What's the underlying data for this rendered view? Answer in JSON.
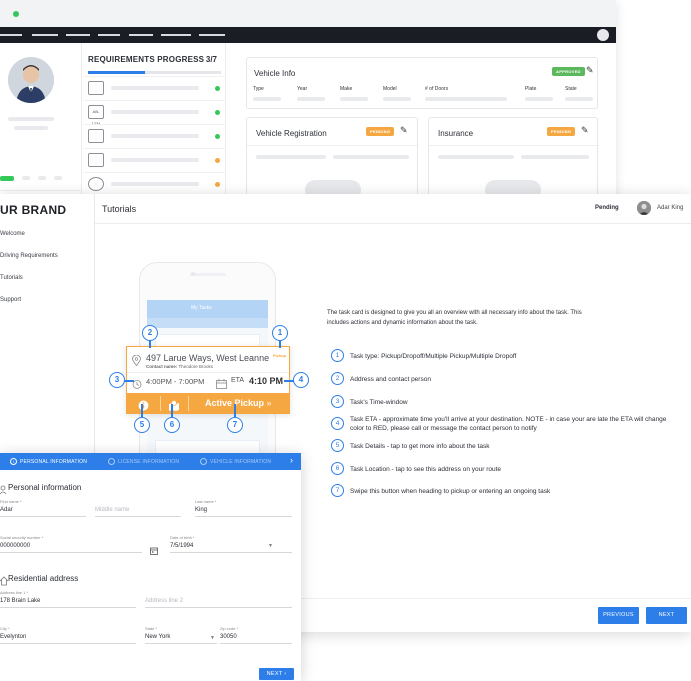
{
  "background_app": {
    "requirements": {
      "title": "REQUIREMENTS PROGRESS",
      "count": "3/7",
      "progress": 0.43,
      "rows": [
        {
          "icon": "id-card-icon",
          "icon_text": "",
          "status_color": "#34c759"
        },
        {
          "icon": "license-plate-icon",
          "icon_text": "AB-1234",
          "status_color": "#34c759"
        },
        {
          "icon": "document-icon",
          "icon_text": "",
          "status_color": "#34c759"
        },
        {
          "icon": "card-icon",
          "icon_text": "",
          "status_color": "#f5a742"
        },
        {
          "icon": "circle-icon",
          "icon_text": "",
          "status_color": "#f5a742"
        }
      ]
    },
    "vehicle_info": {
      "title": "Vehicle Info",
      "badge": "APPROVED",
      "badge_color": "#5cb85c",
      "columns": [
        "Type",
        "Year",
        "Make",
        "Model",
        "# of Doors",
        "Plate",
        "State"
      ]
    },
    "vehicle_registration": {
      "title": "Vehicle Registration",
      "badge": "PENDING",
      "badge_color": "#f5a742"
    },
    "insurance": {
      "title": "Insurance",
      "badge": "PENDING",
      "badge_color": "#f5a742"
    }
  },
  "main": {
    "brand": "UR BRAND",
    "nav": [
      "Welcome",
      "Driving Requirements",
      "Tutorials",
      "Support"
    ],
    "page_title": "Tutorials",
    "status": "Pending",
    "user_name": "Adar King",
    "phone": {
      "app_title": "My Tasks"
    },
    "task_card": {
      "address": "497 Larue Ways, West Leanne",
      "contact_label": "Contact name:",
      "contact_name": "Theodore Brooks",
      "task_type": "Pickup",
      "time_window": "4:00PM - 7:00PM",
      "eta_label": "ETA",
      "eta_value": "4:10 PM",
      "action_label": "Active Pickup",
      "action_arrow": "»"
    },
    "callouts": [
      "1",
      "2",
      "3",
      "4",
      "5",
      "6",
      "7"
    ],
    "description": "The task card is designed to give you all an overview with all necessary info about the task. This includes actions and dynamic information about the task.",
    "legend": [
      {
        "num": "1",
        "text": "Task type: Pickup/Dropoff/Multiple Pickup/Multiple Dropoff"
      },
      {
        "num": "2",
        "text": "Address and contact person"
      },
      {
        "num": "3",
        "text": "Task's Time-window"
      },
      {
        "num": "4",
        "text": "Task ETA - approximate time you'll arrive at your destination. NOTE - in case your are late the ETA will change color to RED, please call or message the contact person to notify"
      },
      {
        "num": "5",
        "text": "Task Details - tap to get more info about the task"
      },
      {
        "num": "6",
        "text": "Task Location - tap to see this address on your route"
      },
      {
        "num": "7",
        "text": "Swipe this button when heading to pickup or entering an ongoing task"
      }
    ],
    "buttons": {
      "previous": "PREVIOUS",
      "next": "NEXT"
    }
  },
  "form": {
    "steps": [
      "PERSONAL INFORMATION",
      "LICENSE INFORMATION",
      "VEHICLE INFORMATION"
    ],
    "personal_title": "Personal information",
    "first_name_label": "First name *",
    "first_name": "Adar",
    "middle_name_placeholder": "Middle name",
    "last_name_label": "Last name *",
    "last_name": "King",
    "ssn_label": "Social security number *",
    "ssn": "000000000",
    "dob_label": "Date of birth *",
    "dob": "7/5/1994",
    "residential_title": "Residential address",
    "address1_label": "Address line 1 *",
    "address1": "178 Brain Lake",
    "address2_placeholder": "Address line 2",
    "city_label": "City *",
    "city": "Evelynton",
    "state_label": "State *",
    "state": "New York",
    "zip_label": "Zip code *",
    "zip": "30050",
    "next_label": "NEXT"
  }
}
